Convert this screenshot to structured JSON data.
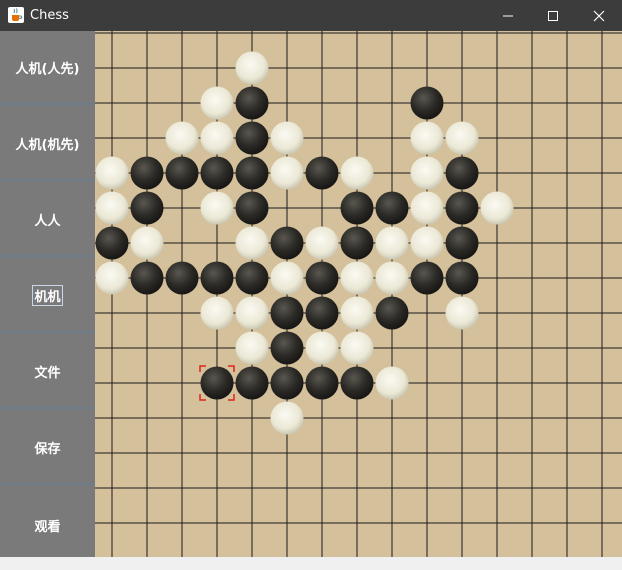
{
  "window": {
    "title": "Chess",
    "app_icon": "java-cup-icon",
    "controls": [
      "minimize-icon",
      "maximize-icon",
      "close-icon"
    ]
  },
  "sidebar": {
    "buttons": [
      {
        "label": "人机(人先)"
      },
      {
        "label": "人机(机先)"
      },
      {
        "label": "人人"
      },
      {
        "label": "机机",
        "focused": true
      },
      {
        "label": "文件"
      },
      {
        "label": "保存"
      },
      {
        "label": "观看"
      }
    ]
  },
  "board": {
    "background": "#d4c09a",
    "line_color": "#1a1a1a",
    "last_move_marker_color": "#e0241b",
    "stones": [
      {
        "col": 4,
        "row": 1,
        "color": "white"
      },
      {
        "col": 3,
        "row": 2,
        "color": "white"
      },
      {
        "col": 4,
        "row": 2,
        "color": "black"
      },
      {
        "col": 9,
        "row": 2,
        "color": "black"
      },
      {
        "col": 2,
        "row": 3,
        "color": "white"
      },
      {
        "col": 3,
        "row": 3,
        "color": "white"
      },
      {
        "col": 4,
        "row": 3,
        "color": "black"
      },
      {
        "col": 5,
        "row": 3,
        "color": "white"
      },
      {
        "col": 9,
        "row": 3,
        "color": "white"
      },
      {
        "col": 10,
        "row": 3,
        "color": "white"
      },
      {
        "col": 0,
        "row": 4,
        "color": "white"
      },
      {
        "col": 1,
        "row": 4,
        "color": "black"
      },
      {
        "col": 2,
        "row": 4,
        "color": "black"
      },
      {
        "col": 3,
        "row": 4,
        "color": "black"
      },
      {
        "col": 4,
        "row": 4,
        "color": "black"
      },
      {
        "col": 5,
        "row": 4,
        "color": "white"
      },
      {
        "col": 6,
        "row": 4,
        "color": "black"
      },
      {
        "col": 7,
        "row": 4,
        "color": "white"
      },
      {
        "col": 9,
        "row": 4,
        "color": "white"
      },
      {
        "col": 10,
        "row": 4,
        "color": "black"
      },
      {
        "col": 0,
        "row": 5,
        "color": "white"
      },
      {
        "col": 1,
        "row": 5,
        "color": "black"
      },
      {
        "col": 3,
        "row": 5,
        "color": "white"
      },
      {
        "col": 4,
        "row": 5,
        "color": "black"
      },
      {
        "col": 7,
        "row": 5,
        "color": "black"
      },
      {
        "col": 8,
        "row": 5,
        "color": "black"
      },
      {
        "col": 9,
        "row": 5,
        "color": "white"
      },
      {
        "col": 10,
        "row": 5,
        "color": "black"
      },
      {
        "col": 11,
        "row": 5,
        "color": "white"
      },
      {
        "col": 0,
        "row": 6,
        "color": "black"
      },
      {
        "col": 1,
        "row": 6,
        "color": "white"
      },
      {
        "col": 4,
        "row": 6,
        "color": "white"
      },
      {
        "col": 5,
        "row": 6,
        "color": "black"
      },
      {
        "col": 6,
        "row": 6,
        "color": "white"
      },
      {
        "col": 7,
        "row": 6,
        "color": "black"
      },
      {
        "col": 8,
        "row": 6,
        "color": "white"
      },
      {
        "col": 9,
        "row": 6,
        "color": "white"
      },
      {
        "col": 10,
        "row": 6,
        "color": "black"
      },
      {
        "col": 0,
        "row": 7,
        "color": "white"
      },
      {
        "col": 1,
        "row": 7,
        "color": "black"
      },
      {
        "col": 2,
        "row": 7,
        "color": "black"
      },
      {
        "col": 3,
        "row": 7,
        "color": "black"
      },
      {
        "col": 4,
        "row": 7,
        "color": "black"
      },
      {
        "col": 5,
        "row": 7,
        "color": "white"
      },
      {
        "col": 6,
        "row": 7,
        "color": "black"
      },
      {
        "col": 7,
        "row": 7,
        "color": "white"
      },
      {
        "col": 8,
        "row": 7,
        "color": "white"
      },
      {
        "col": 9,
        "row": 7,
        "color": "black"
      },
      {
        "col": 10,
        "row": 7,
        "color": "black"
      },
      {
        "col": 3,
        "row": 8,
        "color": "white"
      },
      {
        "col": 4,
        "row": 8,
        "color": "white"
      },
      {
        "col": 5,
        "row": 8,
        "color": "black"
      },
      {
        "col": 6,
        "row": 8,
        "color": "black"
      },
      {
        "col": 7,
        "row": 8,
        "color": "white"
      },
      {
        "col": 8,
        "row": 8,
        "color": "black"
      },
      {
        "col": 10,
        "row": 8,
        "color": "white"
      },
      {
        "col": 4,
        "row": 9,
        "color": "white"
      },
      {
        "col": 5,
        "row": 9,
        "color": "black"
      },
      {
        "col": 6,
        "row": 9,
        "color": "white"
      },
      {
        "col": 7,
        "row": 9,
        "color": "white"
      },
      {
        "col": 3,
        "row": 10,
        "color": "black",
        "last_move": true
      },
      {
        "col": 4,
        "row": 10,
        "color": "black"
      },
      {
        "col": 5,
        "row": 10,
        "color": "black"
      },
      {
        "col": 6,
        "row": 10,
        "color": "black"
      },
      {
        "col": 7,
        "row": 10,
        "color": "black"
      },
      {
        "col": 8,
        "row": 10,
        "color": "white"
      },
      {
        "col": 5,
        "row": 11,
        "color": "white"
      }
    ]
  }
}
